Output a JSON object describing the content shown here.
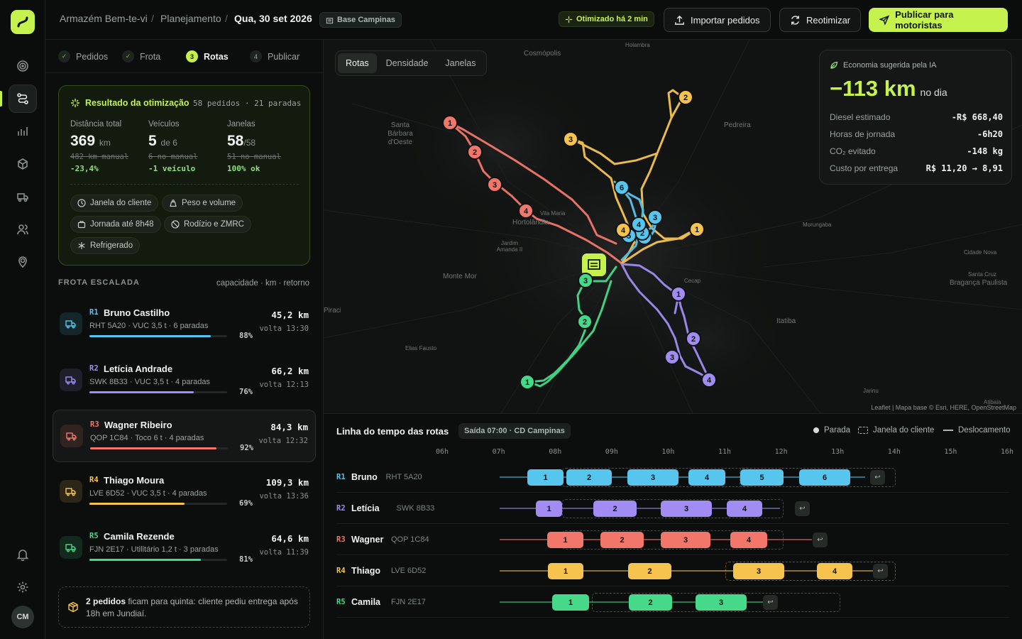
{
  "brand": {
    "accent": "#c6f24e"
  },
  "user": {
    "initials": "CM"
  },
  "breadcrumb": {
    "org": "Armazém Bem-te-vi",
    "section": "Planejamento",
    "date": "Qua, 30 set 2026"
  },
  "base_chip": "Base Campinas",
  "optimized_chip": "Otimizado há 2 min",
  "actions": {
    "import": "Importar pedidos",
    "reoptimize": "Reotimizar",
    "publish": "Publicar para motoristas"
  },
  "steps": [
    {
      "n": "✓",
      "label": "Pedidos"
    },
    {
      "n": "✓",
      "label": "Frota"
    },
    {
      "n": "3",
      "label": "Rotas"
    },
    {
      "n": "4",
      "label": "Publicar"
    }
  ],
  "result": {
    "title": "Resultado da otimização",
    "summary": "58 pedidos · 21 paradas",
    "kpis": [
      {
        "label": "Distância total",
        "value": "369",
        "unit": "km",
        "old": "482 km manual",
        "delta": "-23,4%"
      },
      {
        "label": "Veículos",
        "value": "5",
        "unit": "de 6",
        "old": "6 no manual",
        "delta": "-1 veículo"
      },
      {
        "label": "Janelas",
        "value": "58",
        "unit": "/58",
        "old": "51 no manual",
        "delta": "100% ok"
      }
    ],
    "constraints": [
      "Janela do cliente",
      "Peso e volume",
      "Jornada até 8h48",
      "Rodízio e ZMRC",
      "Refrigerado"
    ]
  },
  "fleet": {
    "heading": "FROTA ESCALADA",
    "legend": "capacidade · km · retorno",
    "vehicles": [
      {
        "code": "R1",
        "name": "Bruno Castilho",
        "meta": "RHT 5A20 · VUC 3,5 t · 6 paradas",
        "load": 88,
        "load_label": "88%",
        "km": "45,2 km",
        "ret": "volta 13:30",
        "color": "#56c6ef"
      },
      {
        "code": "R2",
        "name": "Letícia Andrade",
        "meta": "SWK 8B33 · VUC 3,5 t · 4 paradas",
        "load": 76,
        "load_label": "76%",
        "km": "66,2 km",
        "ret": "volta 12:13",
        "color": "#a08cf2"
      },
      {
        "code": "R3",
        "name": "Wagner Ribeiro",
        "meta": "QOP 1C84 · Toco 6 t · 4 paradas",
        "load": 92,
        "load_label": "92%",
        "km": "84,3 km",
        "ret": "volta 12:32",
        "color": "#f2776a"
      },
      {
        "code": "R4",
        "name": "Thiago Moura",
        "meta": "LVE 6D52 · VUC 3,5 t · 4 paradas",
        "load": 69,
        "load_label": "69%",
        "km": "109,3 km",
        "ret": "volta 13:36",
        "color": "#f6c34f"
      },
      {
        "code": "R5",
        "name": "Camila Rezende",
        "meta": "FJN 2E17 · Utilitário 1,2 t · 3 paradas",
        "load": 81,
        "load_label": "81%",
        "km": "64,6 km",
        "ret": "volta 11:39",
        "color": "#46d98a"
      }
    ]
  },
  "note": {
    "strong": "2 pedidos",
    "text": " ficam para quinta: cliente pediu entrega após 18h em Jundiaí."
  },
  "map": {
    "tabs": [
      "Rotas",
      "Densidade",
      "Janelas"
    ],
    "attribution": "Leaflet | Mapa base © Esri, HERE, OpenStreetMap",
    "labels": [
      "Cosmópolis",
      "Holambra",
      "Pedreira",
      "Santa Bárbara d'Oeste",
      "Vila Maria",
      "Hortolândia",
      "Jardim Amanda II",
      "Monte Mor",
      "Morungaba",
      "Cidade Nova",
      "Santa Cruz",
      "Bragança Paulista",
      "Cecap",
      "Itatiba",
      "Elias Fausto",
      "Jarinu",
      "Atibaia",
      "Piracicaba"
    ],
    "economy": {
      "title": "Economia sugerida pela IA",
      "value": "−113 km",
      "unit": "no dia",
      "rows": [
        {
          "label": "Diesel estimado",
          "value": "-R$ 668,40"
        },
        {
          "label": "Horas de jornada",
          "value": "-6h20"
        },
        {
          "label": "CO₂ evitado",
          "value": "-148 kg"
        },
        {
          "label": "Custo por entrega",
          "value": "R$ 11,20 → 8,91"
        }
      ]
    }
  },
  "timeline": {
    "title": "Linha do tempo das rotas",
    "chip": "Saída 07:00 · CD Campinas",
    "legend": {
      "stop": "Parada",
      "window": "Janela do cliente",
      "travel": "Deslocamento"
    },
    "hours": [
      "06h",
      "07h",
      "08h",
      "09h",
      "10h",
      "11h",
      "12h",
      "13h",
      "14h",
      "15h",
      "16h"
    ],
    "rows": [
      {
        "code": "R1",
        "name": "Bruno",
        "plate": "RHT 5A20",
        "stops": [
          "1",
          "2",
          "3",
          "4",
          "5",
          "6"
        ]
      },
      {
        "code": "R2",
        "name": "Letícia",
        "plate": "SWK 8B33",
        "stops": [
          "1",
          "2",
          "3",
          "4"
        ]
      },
      {
        "code": "R3",
        "name": "Wagner",
        "plate": "QOP 1C84",
        "stops": [
          "1",
          "2",
          "3",
          "4"
        ]
      },
      {
        "code": "R4",
        "name": "Thiago",
        "plate": "LVE 6D52",
        "stops": [
          "1",
          "2",
          "3",
          "4"
        ]
      },
      {
        "code": "R5",
        "name": "Camila",
        "plate": "FJN 2E17",
        "stops": [
          "1",
          "2",
          "3"
        ]
      }
    ],
    "return_glyph": "↩"
  }
}
